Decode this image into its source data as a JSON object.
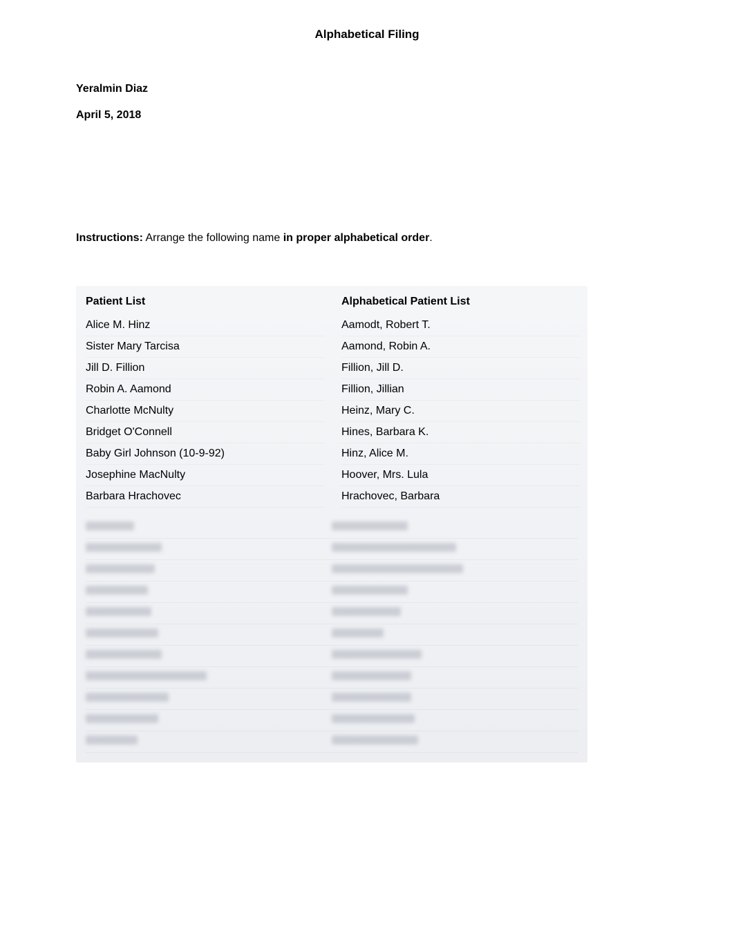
{
  "title": "Alphabetical Filing",
  "author": "Yeralmin Diaz",
  "date": "April 5, 2018",
  "instructions": {
    "label": "Instructions:",
    "text": "  Arrange the following name ",
    "emphasis": "in proper alphabetical order",
    "suffix": "."
  },
  "table": {
    "left_header": "Patient List",
    "right_header": "Alphabetical Patient List",
    "left_rows": [
      "Alice M. Hinz",
      "Sister Mary Tarcisa",
      "Jill D. Fillion",
      "Robin A. Aamond",
      "Charlotte McNulty",
      "Bridget O'Connell",
      "Baby Girl Johnson (10-9-92)",
      "Josephine MacNulty",
      "Barbara Hrachovec"
    ],
    "right_rows": [
      "Aamodt, Robert T.",
      "Aamond, Robin A.",
      "Fillion, Jill D.",
      "Fillion, Jillian",
      "Heinz, Mary C.",
      "Hines, Barbara K.",
      "Hinz, Alice M.",
      "Hoover, Mrs. Lula",
      "Hrachovec, Barbara"
    ]
  },
  "blurred_rows": [
    {
      "left_width": 70,
      "right_width": 110
    },
    {
      "left_width": 110,
      "right_width": 180
    },
    {
      "left_width": 100,
      "right_width": 190
    },
    {
      "left_width": 90,
      "right_width": 110
    },
    {
      "left_width": 95,
      "right_width": 100
    },
    {
      "left_width": 105,
      "right_width": 75
    },
    {
      "left_width": 110,
      "right_width": 130
    },
    {
      "left_width": 175,
      "right_width": 115
    },
    {
      "left_width": 120,
      "right_width": 115
    },
    {
      "left_width": 105,
      "right_width": 120
    },
    {
      "left_width": 75,
      "right_width": 125
    }
  ]
}
